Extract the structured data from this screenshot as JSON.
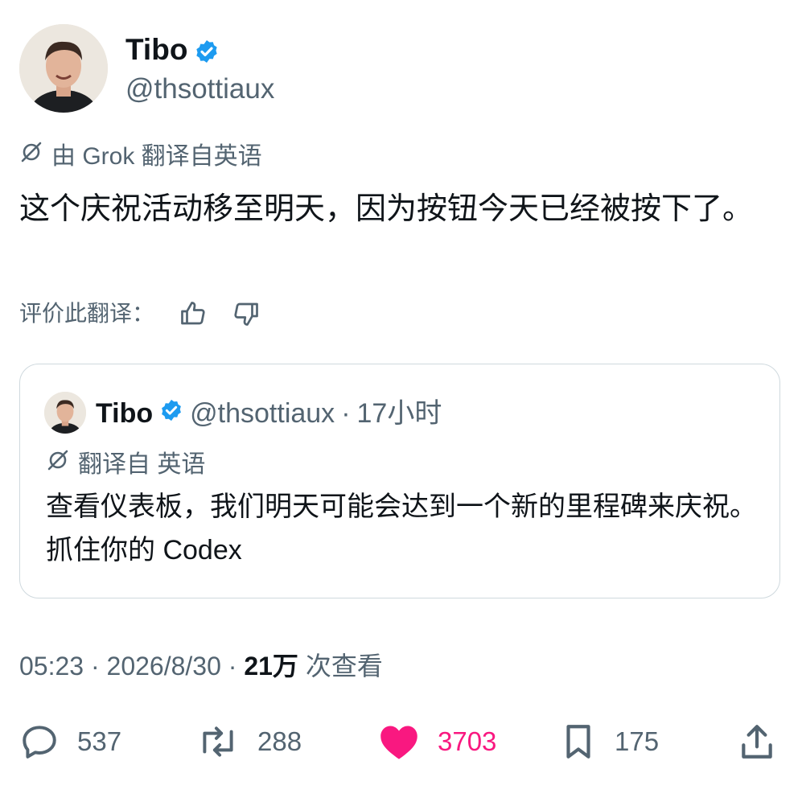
{
  "author": {
    "name": "Tibo",
    "handle": "@thsottiaux",
    "verified": true
  },
  "translation": {
    "label": "由 Grok 翻译自英语",
    "rate_label": "评价此翻译："
  },
  "post_text": "这个庆祝活动移至明天，因为按钮今天已经被按下了。",
  "quoted_post": {
    "name": "Tibo",
    "handle": "@thsottiaux",
    "separator": "·",
    "time": "17小时",
    "translation_label": "翻译自 英语",
    "text": "查看仪表板，我们明天可能会达到一个新的里程碑来庆祝。抓住你的 Codex"
  },
  "meta": {
    "time": "05:23",
    "sep1": " · ",
    "date": "2026/8/30",
    "sep2": " · ",
    "views_count": "21万",
    "views_label": " 次查看"
  },
  "actions": {
    "replies": "537",
    "reposts": "288",
    "likes": "3703",
    "bookmarks": "175"
  },
  "colors": {
    "verified": "#1d9bf0",
    "like": "#f91880",
    "secondary_text": "#536471"
  },
  "icons": [
    "verified-badge-icon",
    "grok-icon",
    "thumbs-up-icon",
    "thumbs-down-icon",
    "reply-icon",
    "repost-icon",
    "like-heart-icon",
    "bookmark-icon",
    "share-icon"
  ]
}
